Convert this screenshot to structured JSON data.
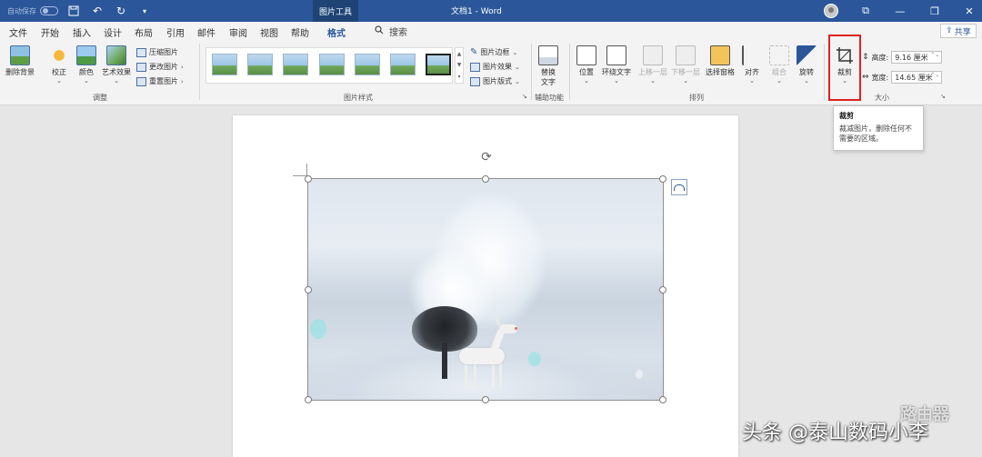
{
  "titlebar": {
    "autosave_label": "自动保存",
    "context_tab": "图片工具",
    "document_title": "文档1 - Word",
    "icons": [
      "save-icon",
      "undo-icon",
      "redo-icon",
      "customize-icon",
      "avatar",
      "ribbon-display-icon",
      "minimize-icon",
      "restore-icon",
      "close-icon"
    ]
  },
  "menu": {
    "tabs": [
      "文件",
      "开始",
      "插入",
      "设计",
      "布局",
      "引用",
      "邮件",
      "审阅",
      "视图",
      "帮助",
      "格式"
    ],
    "active_tab": "格式",
    "search_label": "搜索",
    "share_label": "共享"
  },
  "ribbon": {
    "adjust": {
      "remove_bg": "删除背景",
      "corrections": "校正",
      "color": "颜色",
      "artistic": "艺术效果",
      "compress": "压缩图片",
      "change": "更改图片",
      "reset": "重置图片",
      "group_label": "调整"
    },
    "styles": {
      "border": "图片边框",
      "effects": "图片效果",
      "layout": "图片版式",
      "group_label": "图片样式"
    },
    "accessibility": {
      "alt_text_line1": "替换",
      "alt_text_line2": "文字",
      "group_label": "辅助功能"
    },
    "arrange": {
      "position": "位置",
      "wrap": "环绕文字",
      "forward": "上移一层",
      "backward": "下移一层",
      "pane": "选择窗格",
      "align": "对齐",
      "group": "组合",
      "rotate": "旋转",
      "group_label": "排列"
    },
    "size": {
      "crop": "裁剪",
      "height_label": "高度:",
      "height_value": "9.16 厘米",
      "width_label": "宽度:",
      "width_value": "14.65 厘米",
      "group_label": "大小"
    }
  },
  "tooltip": {
    "title": "裁剪",
    "body": "裁减图片，删除任何不需要的区域。"
  },
  "watermark": {
    "text": "头条 @泰山数码小李",
    "logo_text": "路由器"
  },
  "colors": {
    "title_bar": "#2b579a",
    "highlight": "#e02020"
  }
}
